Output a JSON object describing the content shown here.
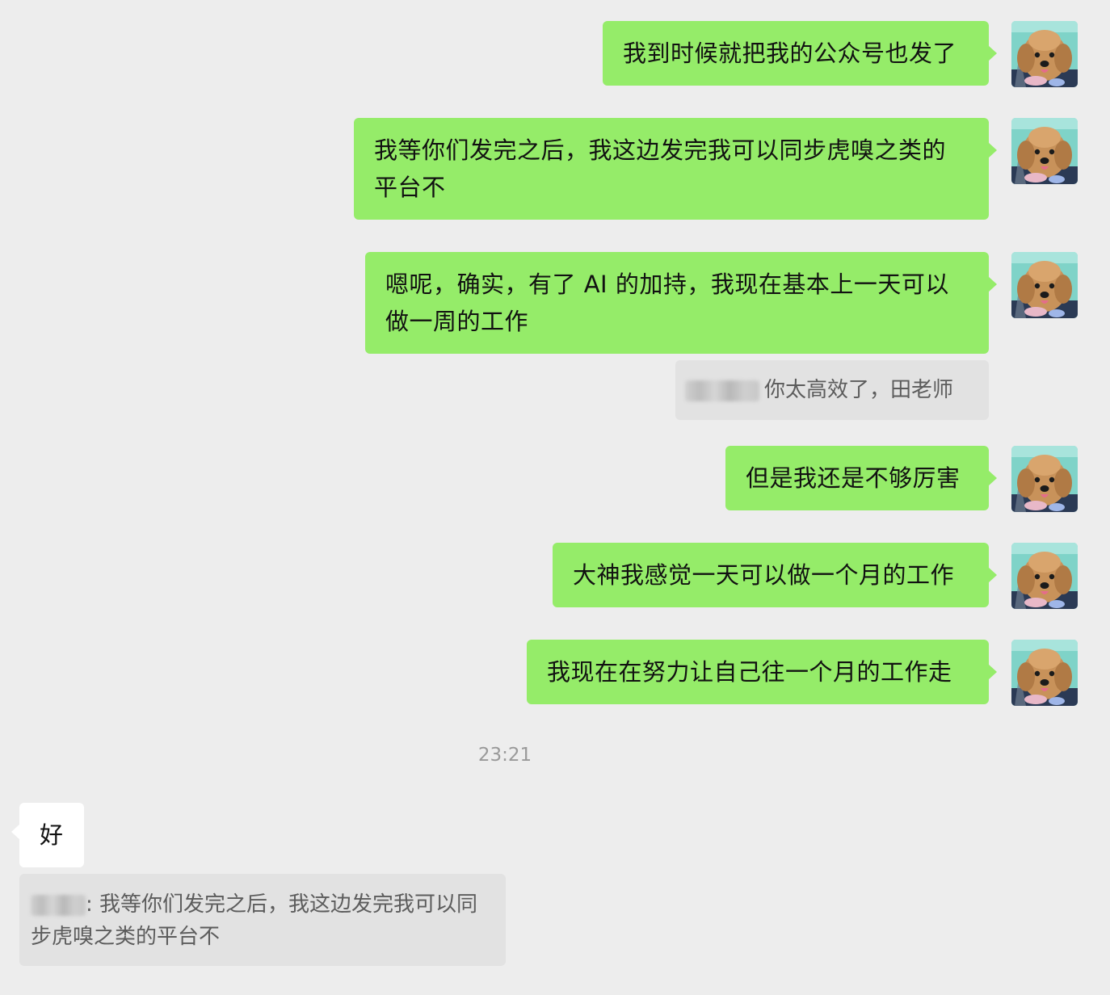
{
  "messages": [
    {
      "side": "me",
      "text": "我到时候就把我的公众号也发了"
    },
    {
      "side": "me",
      "text": "我等你们发完之后，我这边发完我可以同步虎嗅之类的平台不"
    },
    {
      "side": "me",
      "text": "嗯呢，确实，有了 AI 的加持，我现在基本上一天可以做一周的工作"
    },
    {
      "quote": "你太高效了，田老师"
    },
    {
      "side": "me",
      "text": "但是我还是不够厉害"
    },
    {
      "side": "me",
      "text": "大神我感觉一天可以做一个月的工作"
    },
    {
      "side": "me",
      "text": "我现在在努力让自己往一个月的工作走"
    },
    {
      "timestamp": "23:21"
    },
    {
      "side": "other",
      "text": "好"
    },
    {
      "quote": "我等你们发完之后，我这边发完我可以同步虎嗅之类的平台不",
      "prefix": ":"
    }
  ],
  "avatar": {
    "icon": "dog-avatar-icon",
    "bg_color": "#7fd3c8",
    "fur_color": "#c8925a"
  },
  "colors": {
    "my_bubble": "#95ec69",
    "other_bubble": "#ffffff",
    "quote_bg": "#e2e2e2",
    "background": "#ededed"
  }
}
